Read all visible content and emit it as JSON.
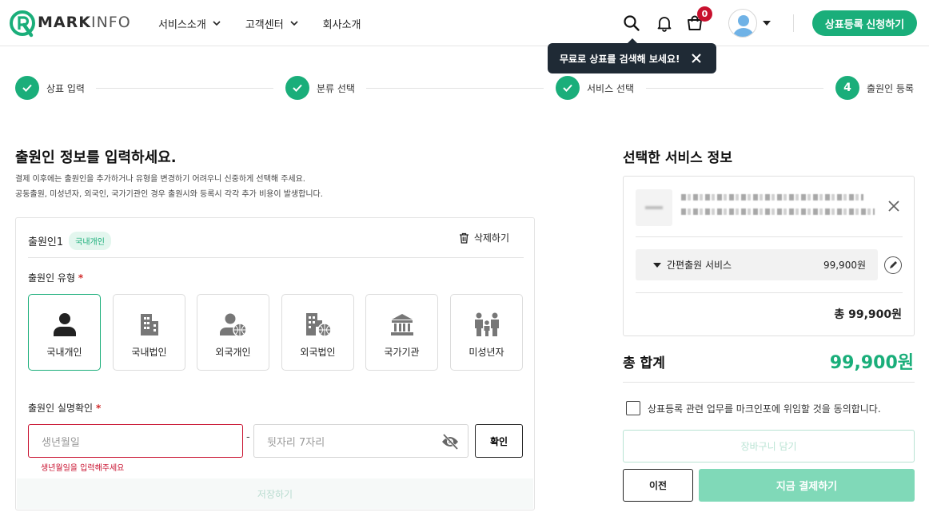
{
  "brand": {
    "name_bold": "MARK",
    "name_light": "INFO"
  },
  "nav": {
    "items": [
      {
        "label": "서비스소개"
      },
      {
        "label": "고객센터"
      },
      {
        "label": "회사소개"
      }
    ]
  },
  "header": {
    "cart_count": "0",
    "apply_label": "상표등록 신청하기"
  },
  "tooltip": {
    "text": "무료로 상표를 검색해 보세요!"
  },
  "steps": [
    {
      "label": "상표 입력",
      "state": "done"
    },
    {
      "label": "분류 선택",
      "state": "done"
    },
    {
      "label": "서비스 선택",
      "state": "done"
    },
    {
      "label": "출원인 등록",
      "number": "4",
      "state": "current"
    }
  ],
  "form": {
    "title": "출원인 정보를 입력하세요.",
    "desc_1": "결제 이후에는 출원인을 추가하거나 유형을 변경하기 어려우니 신중하게 선택해 주세요.",
    "desc_2": "공동출원, 미성년자, 외국인, 국가기관인 경우 출원시와 등록시 각각 추가 비용이 발생합니다.",
    "applicant_title": "출원인1",
    "applicant_badge": "국내개인",
    "delete_label": "삭제하기",
    "type_label": "출원인 유형",
    "required_mark": "*",
    "types": [
      {
        "label": "국내개인",
        "icon": "person-icon",
        "selected": true
      },
      {
        "label": "국내법인",
        "icon": "building-icon",
        "selected": false
      },
      {
        "label": "외국개인",
        "icon": "foreign-person-icon",
        "selected": false
      },
      {
        "label": "외국법인",
        "icon": "foreign-building-icon",
        "selected": false
      },
      {
        "label": "국가기관",
        "icon": "government-icon",
        "selected": false
      },
      {
        "label": "미성년자",
        "icon": "family-icon",
        "selected": false
      }
    ],
    "verify_label": "출원인 실명확인",
    "birth_placeholder": "생년월일",
    "id_placeholder": "뒷자리 7자리",
    "dash": "-",
    "confirm_label": "확인",
    "error_message": "생년월일을 입력해주세요",
    "save_label": "저장하기"
  },
  "summary": {
    "title": "선택한 서비스 정보",
    "service_name": "간편출원 서비스",
    "service_price": "99,900원",
    "subtotal": "총 99,900원",
    "grand_label": "총 합계",
    "grand_value": "99,900원",
    "agree_text": "상표등록 관련 업무를 마크인포에 위임할 것을 동의합니다.",
    "cart_label": "장바구니 담기",
    "prev_label": "이전",
    "pay_label": "지금 결제하기"
  },
  "colors": {
    "accent": "#1aae7a",
    "error": "#c8102e"
  }
}
